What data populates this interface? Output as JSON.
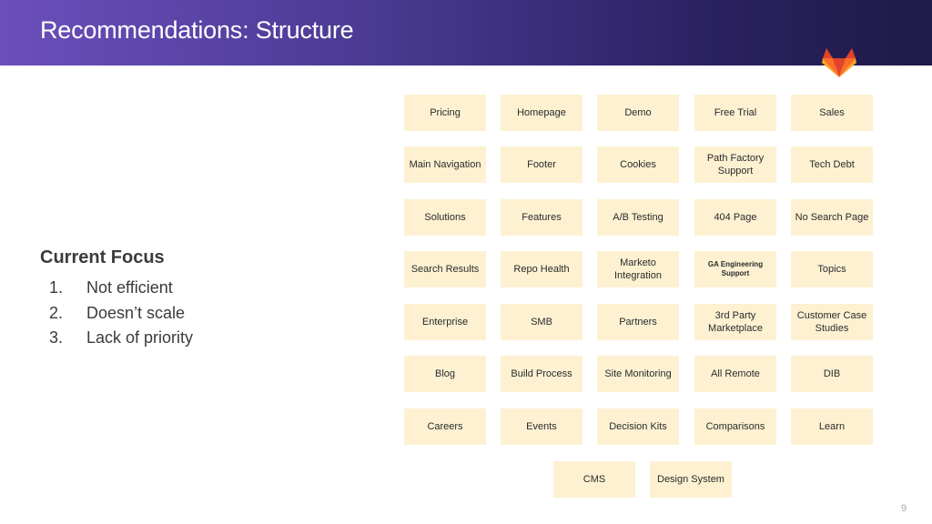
{
  "slide": {
    "title": "Recommendations: Structure",
    "page_number": "9"
  },
  "focus": {
    "heading": "Current Focus",
    "items": [
      {
        "num": "1.",
        "text": "Not efficient"
      },
      {
        "num": "2.",
        "text": "Doesn’t scale"
      },
      {
        "num": "3.",
        "text": "Lack of priority"
      }
    ]
  },
  "tiles": {
    "r0": [
      "Pricing",
      "Homepage",
      "Demo",
      "Free Trial",
      "Sales"
    ],
    "r1": [
      "Main Navigation",
      "Footer",
      "Cookies",
      "Path Factory Support",
      "Tech Debt"
    ],
    "r2": [
      "Solutions",
      "Features",
      "A/B Testing",
      "404 Page",
      "No Search Page"
    ],
    "r3": [
      "Search Results",
      "Repo Health",
      "Marketo Integration",
      "GA Engineering Support",
      "Topics"
    ],
    "r4": [
      "Enterprise",
      "SMB",
      "Partners",
      "3rd Party Marketplace",
      "Customer Case Studies"
    ],
    "r5": [
      "Blog",
      "Build Process",
      "Site Monitoring",
      "All Remote",
      "DIB"
    ],
    "r6": [
      "Careers",
      "Events",
      "Decision Kits",
      "Comparisons",
      "Learn"
    ],
    "r7": [
      "CMS",
      "Design System"
    ]
  },
  "colors": {
    "header_start": "#6b4fbb",
    "header_end": "#1f1a47",
    "tile_bg": "#fdf1d2",
    "logo": [
      "#e24329",
      "#fc6d26",
      "#fca326"
    ]
  },
  "icons": {
    "logo": "gitlab-tanuki-icon"
  }
}
